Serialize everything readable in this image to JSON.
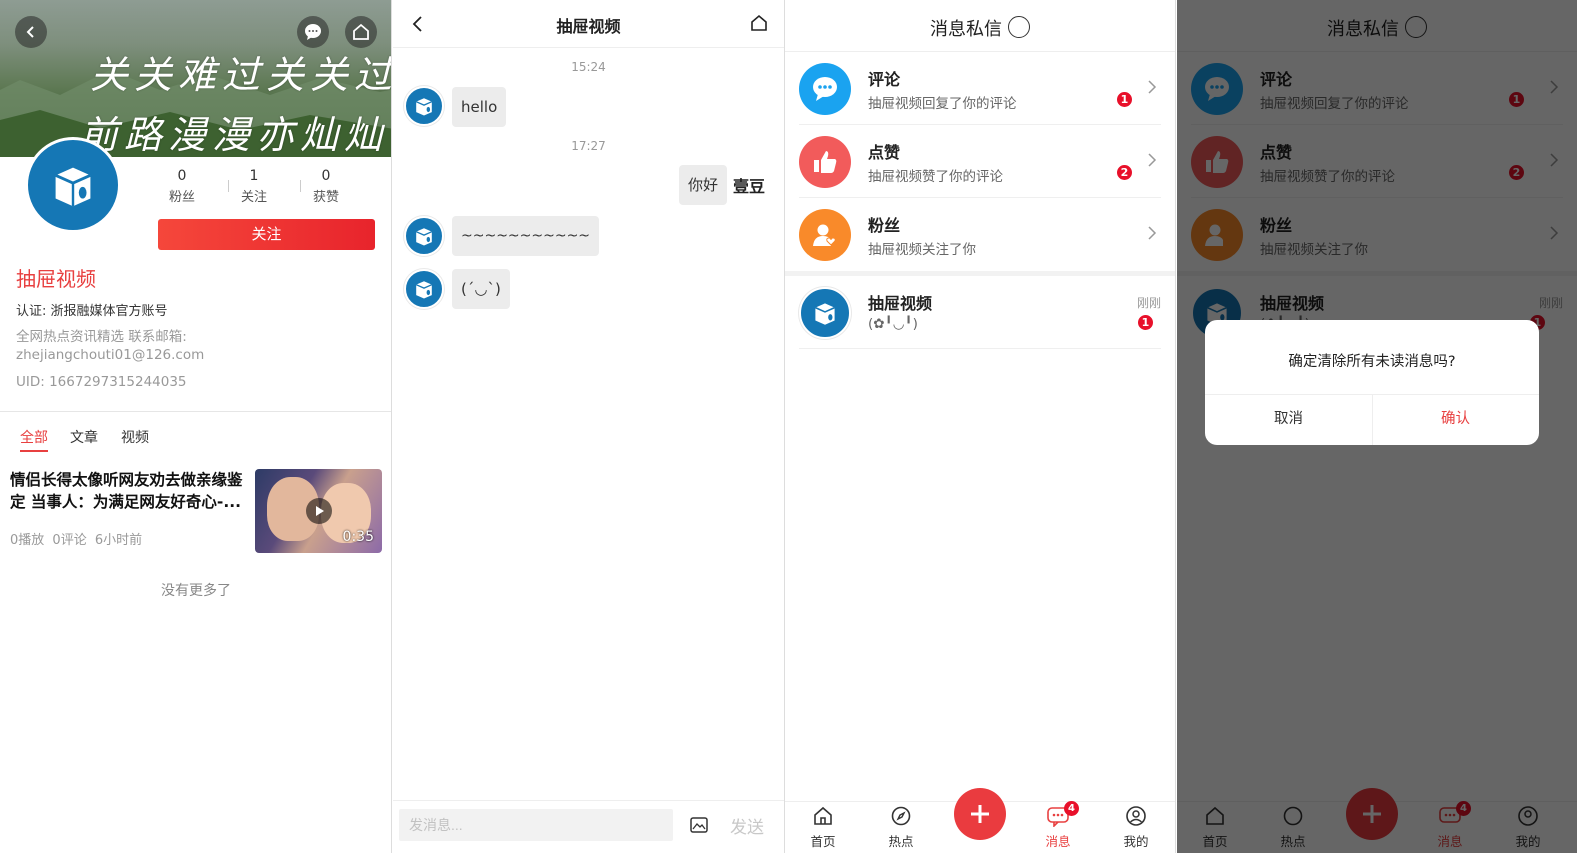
{
  "profile": {
    "banner_text_line1": "关关难过关关过",
    "banner_text_line2": "前路漫漫亦灿灿",
    "stats": [
      {
        "value": "0",
        "label": "粉丝"
      },
      {
        "value": "1",
        "label": "关注"
      },
      {
        "value": "0",
        "label": "获赞"
      }
    ],
    "follow_label": "关注",
    "name": "抽屉视频",
    "certification": "认证: 浙报融媒体官方账号",
    "description": "全网热点资讯精选 联系邮箱: zhejiangchouti01@126.com",
    "uid": "UID: 1667297315244035",
    "tabs": [
      "全部",
      "文章",
      "视频"
    ],
    "news": {
      "title": "情侣长得太像听网友劝去做亲缘鉴定 当事人：为满足网友好奇心-...",
      "plays": "0播放",
      "comments": "0评论",
      "time": "6小时前",
      "duration": "0:35"
    },
    "no_more": "没有更多了"
  },
  "chat": {
    "title": "抽屉视频",
    "messages": [
      {
        "time": "15:24",
        "text": "hello"
      },
      {
        "time": "17:27",
        "self_text": "你好",
        "self_avatar_text": "壹豆"
      },
      {
        "text": "~~~~~~~~~~~"
      },
      {
        "text": "(´◡`)"
      }
    ],
    "input_placeholder": "发消息...",
    "send_label": "发送"
  },
  "messages": {
    "title": "消息私信",
    "rows": [
      {
        "name": "评论",
        "sub": "抽屉视频回复了你的评论",
        "badge": "1",
        "color": "#1aa3f0"
      },
      {
        "name": "点赞",
        "sub": "抽屉视频赞了你的评论",
        "badge": "2",
        "color": "#f25b5b"
      },
      {
        "name": "粉丝",
        "sub": "抽屉视频关注了你",
        "badge": "",
        "color": "#f98a2a"
      }
    ],
    "dm": {
      "name": "抽屉视频",
      "sub": "(✿╹◡╹)",
      "time": "刚刚",
      "badge": "1"
    },
    "tabbar": [
      {
        "label": "首页",
        "icon": "home-icon"
      },
      {
        "label": "热点",
        "icon": "compass-icon"
      },
      {
        "label": "",
        "icon": "plus-icon"
      },
      {
        "label": "消息",
        "icon": "message-icon",
        "badge": "4",
        "active": true
      },
      {
        "label": "我的",
        "icon": "user-icon"
      }
    ]
  },
  "dialog": {
    "message": "确定清除所有未读消息吗?",
    "cancel": "取消",
    "confirm": "确认"
  }
}
